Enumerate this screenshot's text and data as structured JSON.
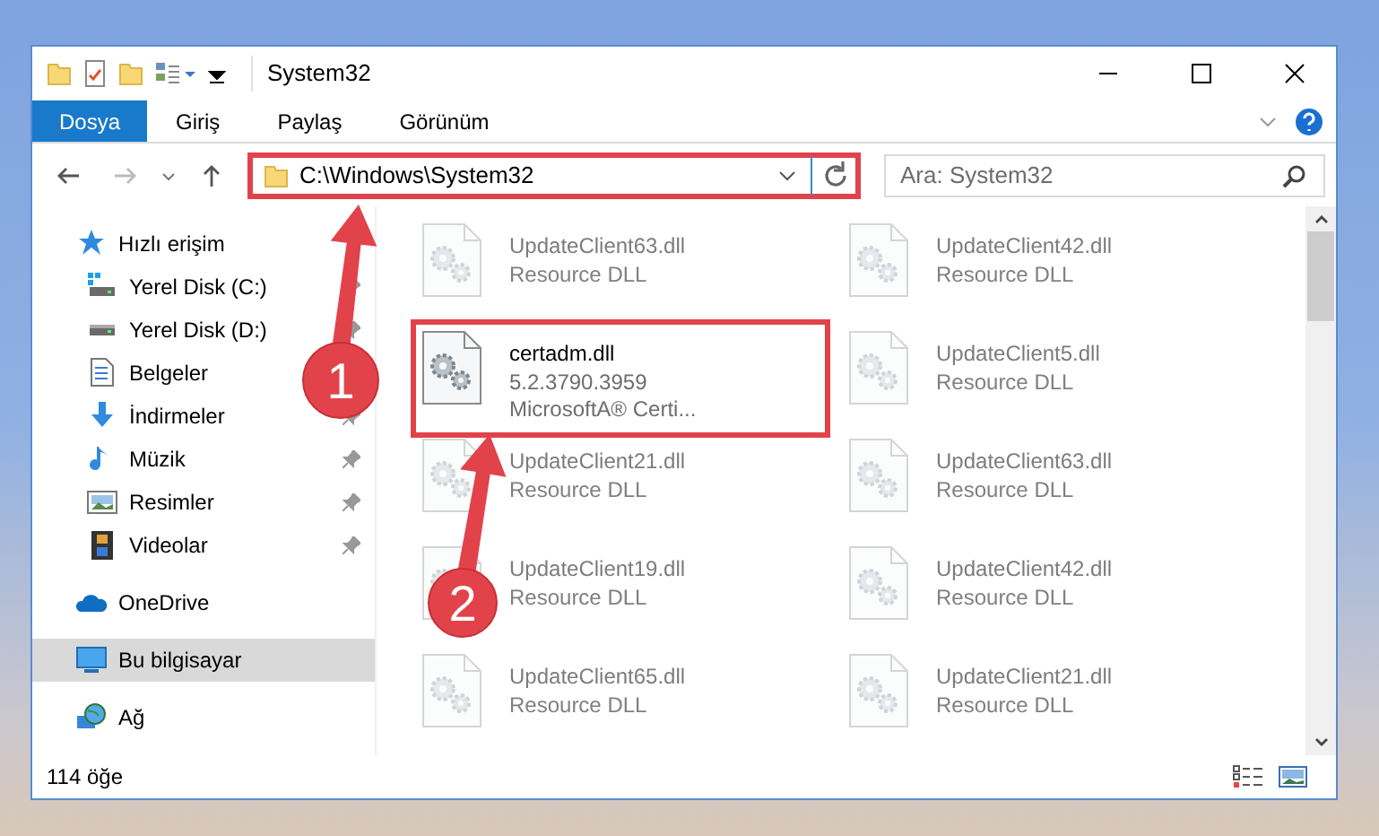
{
  "window": {
    "title": "System32"
  },
  "ribbon_tabs": [
    {
      "label": "Dosya",
      "kind": "file"
    },
    {
      "label": "Giriş",
      "kind": "tab"
    },
    {
      "label": "Paylaş",
      "kind": "tab"
    },
    {
      "label": "Görünüm",
      "kind": "tab"
    }
  ],
  "address": {
    "path": "C:\\Windows\\System32",
    "highlighted": true
  },
  "search": {
    "placeholder": "Ara: System32"
  },
  "nav": [
    {
      "label": "Hızlı erişim",
      "kind": "star",
      "selected": false,
      "children": [
        {
          "label": "Yerel Disk (C:)",
          "kind": "drive-c",
          "pinned": true,
          "selected": false
        },
        {
          "label": "Yerel Disk (D:)",
          "kind": "drive",
          "pinned": true,
          "selected": false
        },
        {
          "label": "Belgeler",
          "kind": "document",
          "pinned": false,
          "selected": false
        },
        {
          "label": "İndirmeler",
          "kind": "download",
          "pinned": true,
          "selected": false
        },
        {
          "label": "Müzik",
          "kind": "music",
          "pinned": true,
          "selected": false
        },
        {
          "label": "Resimler",
          "kind": "picture",
          "pinned": true,
          "selected": false
        },
        {
          "label": "Videolar",
          "kind": "video",
          "pinned": true,
          "selected": false
        }
      ]
    },
    {
      "label": "OneDrive",
      "kind": "cloud",
      "selected": false
    },
    {
      "label": "Bu bilgisayar",
      "kind": "computer",
      "selected": true
    },
    {
      "label": "Ağ",
      "kind": "network",
      "selected": false
    }
  ],
  "files": [
    {
      "name": "UpdateClient63.dll",
      "details": [
        "Resource DLL"
      ],
      "faded": true,
      "highlighted": false
    },
    {
      "name": "UpdateClient42.dll",
      "details": [
        "Resource DLL"
      ],
      "faded": true,
      "highlighted": false
    },
    {
      "name": "certadm.dll",
      "details": [
        "5.2.3790.3959",
        "MicrosoftA® Certi..."
      ],
      "faded": false,
      "highlighted": true
    },
    {
      "name": "UpdateClient5.dll",
      "details": [
        "Resource DLL"
      ],
      "faded": true,
      "highlighted": false
    },
    {
      "name": "UpdateClient21.dll",
      "details": [
        "Resource DLL"
      ],
      "faded": true,
      "highlighted": false
    },
    {
      "name": "UpdateClient63.dll",
      "details": [
        "Resource DLL"
      ],
      "faded": true,
      "highlighted": false
    },
    {
      "name": "UpdateClient19.dll",
      "details": [
        "Resource DLL"
      ],
      "faded": true,
      "highlighted": false
    },
    {
      "name": "UpdateClient42.dll",
      "details": [
        "Resource DLL"
      ],
      "faded": true,
      "highlighted": false
    },
    {
      "name": "UpdateClient65.dll",
      "details": [
        "Resource DLL"
      ],
      "faded": true,
      "highlighted": false
    },
    {
      "name": "UpdateClient21.dll",
      "details": [
        "Resource DLL"
      ],
      "faded": true,
      "highlighted": false
    }
  ],
  "status_bar": {
    "item_count": "114 öğe"
  },
  "annotations": [
    {
      "number": "1"
    },
    {
      "number": "2"
    }
  ]
}
